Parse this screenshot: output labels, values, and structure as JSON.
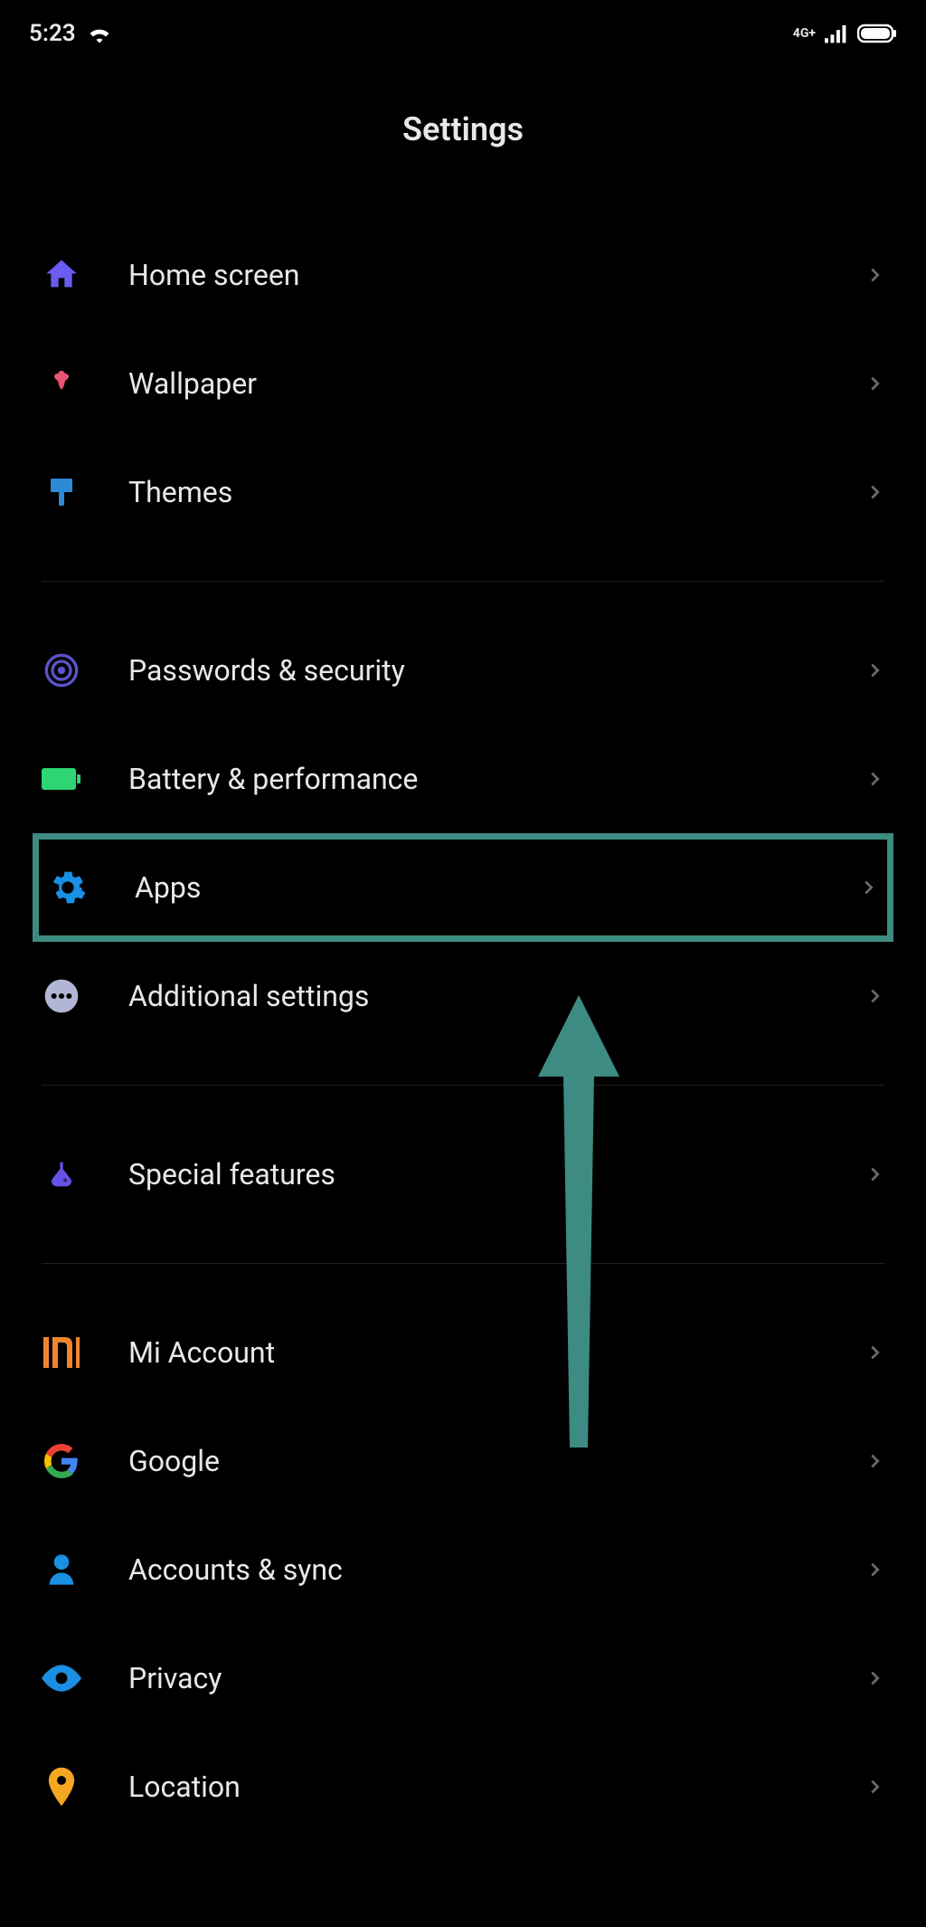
{
  "statusBar": {
    "time": "5:23",
    "network": "4G+"
  },
  "header": {
    "title": "Settings"
  },
  "groups": [
    {
      "items": [
        {
          "id": "home-screen",
          "label": "Home screen",
          "icon": "home-icon",
          "color": "#6a5cf0"
        },
        {
          "id": "wallpaper",
          "label": "Wallpaper",
          "icon": "flower-icon",
          "color": "#e75370"
        },
        {
          "id": "themes",
          "label": "Themes",
          "icon": "brush-icon",
          "color": "#2e8ad6"
        }
      ]
    },
    {
      "items": [
        {
          "id": "passwords-security",
          "label": "Passwords & security",
          "icon": "fingerprint-icon",
          "color": "#5a53c9"
        },
        {
          "id": "battery",
          "label": "Battery & performance",
          "icon": "battery-icon",
          "color": "#2ed573"
        },
        {
          "id": "apps",
          "label": "Apps",
          "icon": "gear-icon",
          "color": "#1a8fe3",
          "highlighted": true
        },
        {
          "id": "additional",
          "label": "Additional settings",
          "icon": "dots-icon",
          "color": "#b0b6d4"
        }
      ]
    },
    {
      "items": [
        {
          "id": "special-features",
          "label": "Special features",
          "icon": "flask-icon",
          "color": "#6752e6"
        }
      ]
    },
    {
      "items": [
        {
          "id": "mi-account",
          "label": "Mi Account",
          "icon": "mi-icon",
          "color": "#f0862c"
        },
        {
          "id": "google",
          "label": "Google",
          "icon": "google-icon",
          "color": "#4285f4"
        },
        {
          "id": "accounts-sync",
          "label": "Accounts & sync",
          "icon": "person-icon",
          "color": "#1a8fe3"
        },
        {
          "id": "privacy",
          "label": "Privacy",
          "icon": "eye-icon",
          "color": "#1a8fe3"
        },
        {
          "id": "location",
          "label": "Location",
          "icon": "pin-icon",
          "color": "#f5a623"
        }
      ]
    }
  ]
}
